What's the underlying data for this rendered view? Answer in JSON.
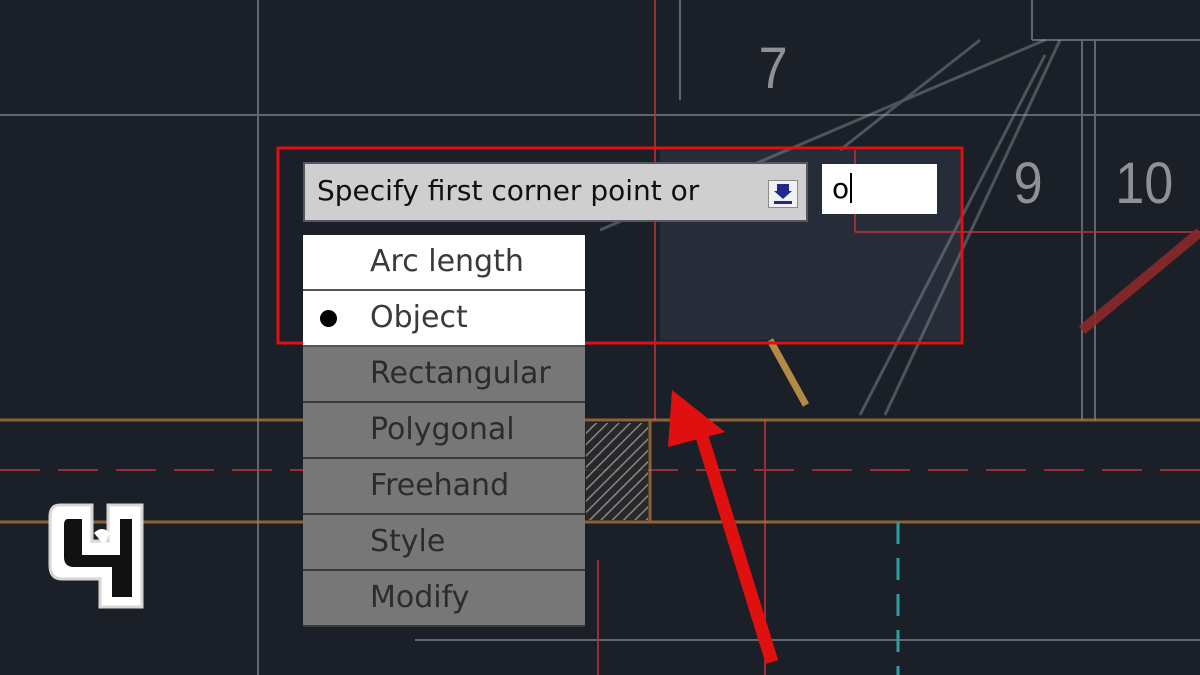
{
  "drawing": {
    "area_numbers": [
      "7",
      "9",
      "10"
    ]
  },
  "command_prompt": {
    "text": "Specify first corner point or",
    "dropdown_icon": "dropdown-arrow-icon"
  },
  "command_input": {
    "value": "o"
  },
  "options_menu": {
    "items": [
      {
        "label": "Arc length",
        "active": true,
        "selected": false
      },
      {
        "label": "Object",
        "active": true,
        "selected": true
      },
      {
        "label": "Rectangular",
        "active": false,
        "selected": false
      },
      {
        "label": "Polygonal",
        "active": false,
        "selected": false
      },
      {
        "label": "Freehand",
        "active": false,
        "selected": false
      },
      {
        "label": "Style",
        "active": false,
        "selected": false
      },
      {
        "label": "Modify",
        "active": false,
        "selected": false
      }
    ]
  },
  "annotation": {
    "highlight_color": "#e01010",
    "arrow_color": "#e01010"
  },
  "logo": {
    "icon": "channel-logo-icon"
  },
  "colors": {
    "background": "#1b1f27",
    "grid_line": "#9aa1ab",
    "construction_red": "#b8333a",
    "construction_orange": "#b57a3a",
    "construction_cyan": "#2e9fa0",
    "menu_active": "#ffffff",
    "menu_inactive": "#777777"
  }
}
